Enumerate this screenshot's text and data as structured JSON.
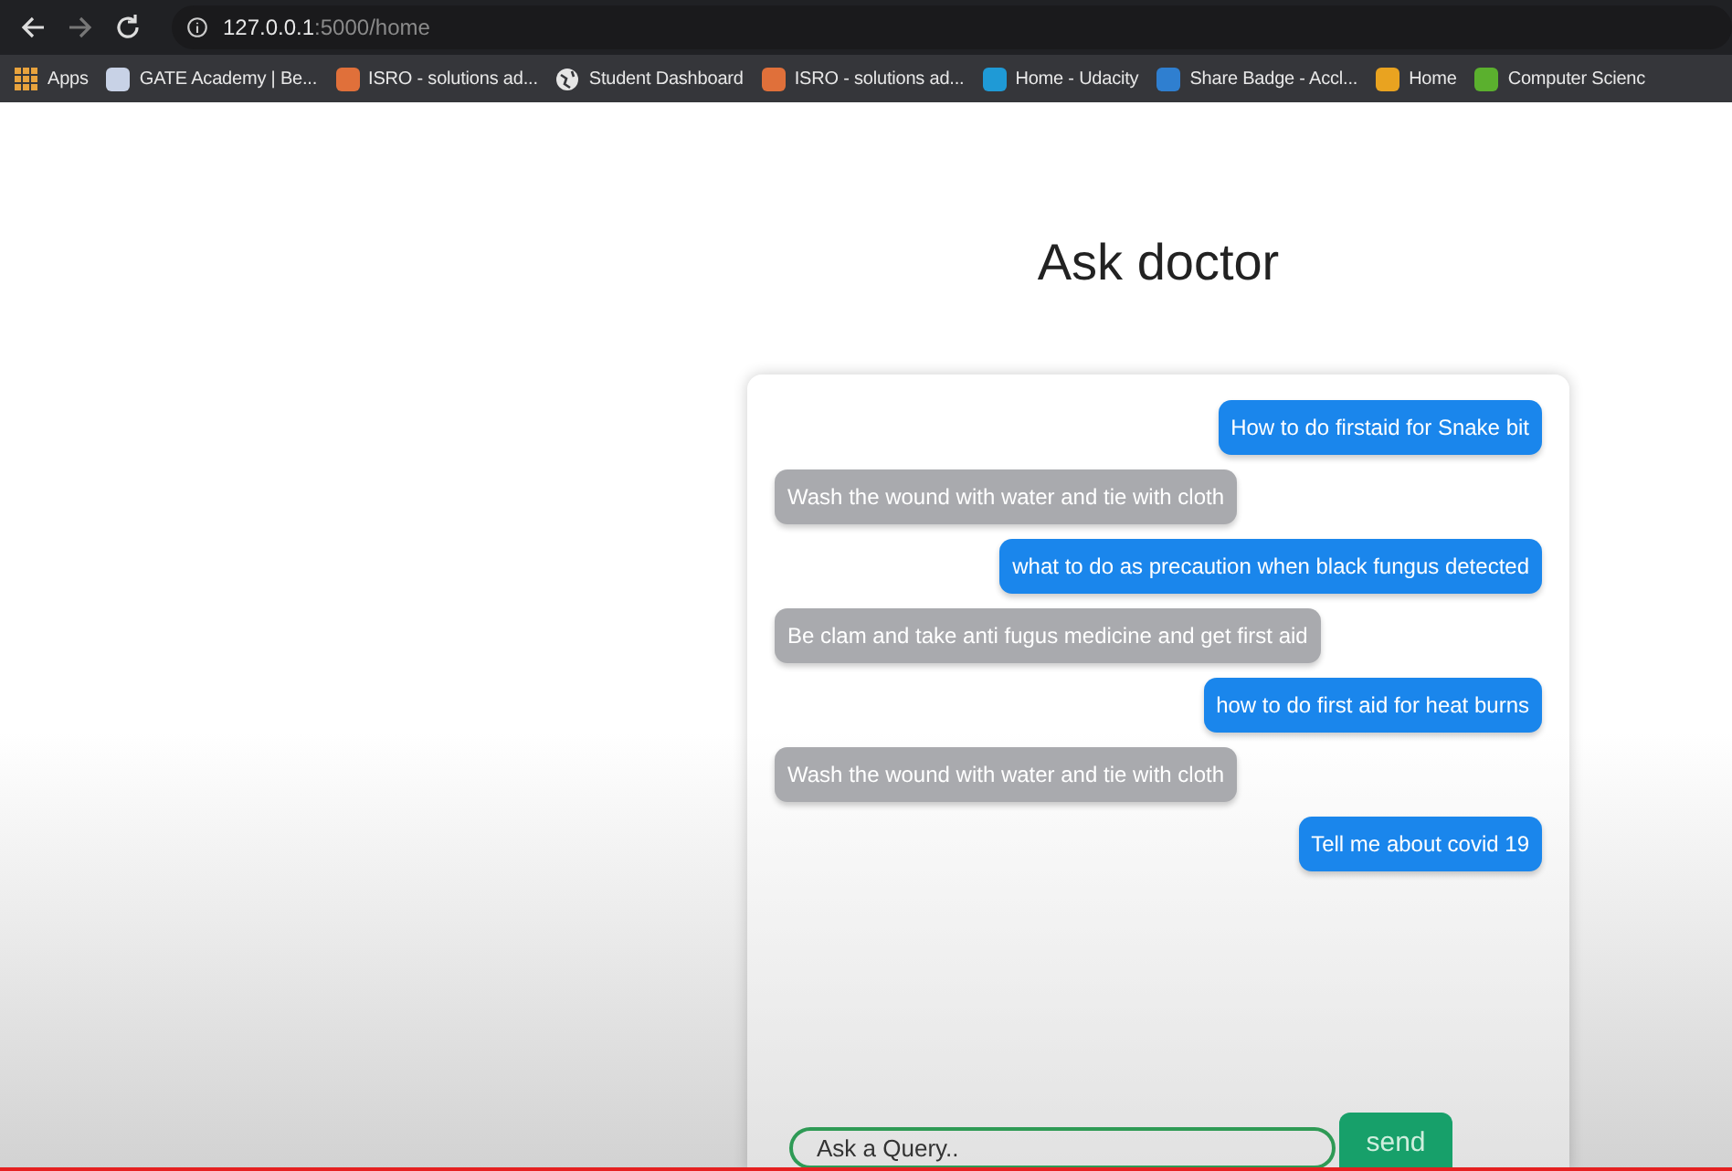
{
  "browser": {
    "url_host": "127.0.0.1",
    "url_rest": ":5000/home",
    "bookmarks": [
      {
        "kind": "apps",
        "label": "Apps",
        "color": "#e8a33d"
      },
      {
        "kind": "site",
        "label": "GATE Academy | Be...",
        "color": "#c8d2e6"
      },
      {
        "kind": "site",
        "label": "ISRO - solutions ad...",
        "color": "#e0703a"
      },
      {
        "kind": "globe",
        "label": "Student Dashboard",
        "color": "#e6e6e6"
      },
      {
        "kind": "site",
        "label": "ISRO - solutions ad...",
        "color": "#e0703a"
      },
      {
        "kind": "site",
        "label": "Home - Udacity",
        "color": "#1f9ad6"
      },
      {
        "kind": "site",
        "label": "Share Badge - Accl...",
        "color": "#2f7fd0"
      },
      {
        "kind": "site",
        "label": "Home",
        "color": "#e9a320"
      },
      {
        "kind": "site",
        "label": "Computer Scienc",
        "color": "#5bb02e"
      }
    ]
  },
  "title": "Ask doctor",
  "messages": [
    {
      "kind": "user",
      "text": "How to do firstaid for Snake bit"
    },
    {
      "kind": "bot",
      "text": "Wash the wound with water and tie with cloth"
    },
    {
      "kind": "user",
      "text": "what to do as precaution when black fungus detected"
    },
    {
      "kind": "bot",
      "text": "Be clam and take anti fugus medicine and get first aid"
    },
    {
      "kind": "user",
      "text": "how to do first aid for heat burns"
    },
    {
      "kind": "bot",
      "text": "Wash the wound with water and tie with cloth"
    },
    {
      "kind": "user",
      "text": "Tell me about covid 19"
    }
  ],
  "input": {
    "placeholder": "Ask a Query.."
  },
  "send_button": "send"
}
